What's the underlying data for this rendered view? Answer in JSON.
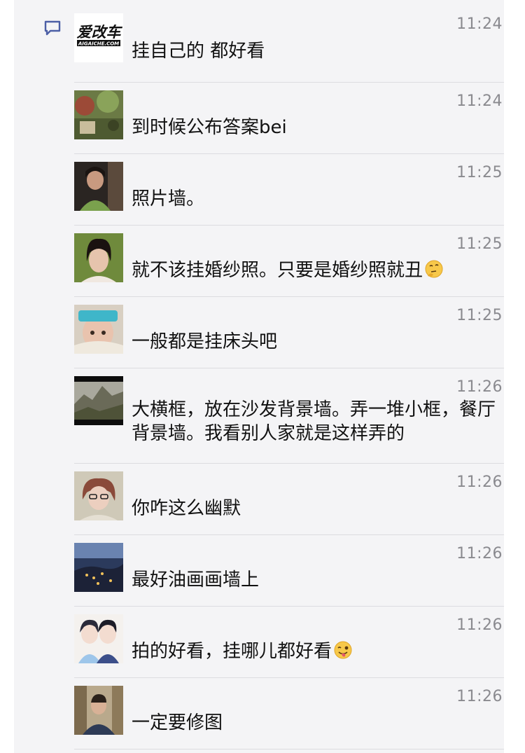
{
  "comments": [
    {
      "time": "11:24",
      "text": "挂自己的 都好看",
      "emoji": "",
      "avatar": "aichezhan-logo",
      "logo_main": "爱改车",
      "logo_sub": "AIGAICHE.COM"
    },
    {
      "time": "11:24",
      "text": "到时候公布答案bei",
      "emoji": "",
      "avatar": "garden-photo"
    },
    {
      "time": "11:25",
      "text": "照片墙。",
      "emoji": "",
      "avatar": "woman-dark-photo"
    },
    {
      "time": "11:25",
      "text": "就不该挂婚纱照。只要是婚纱照就丑",
      "emoji": "thinking-face-icon",
      "avatar": "woman-portrait-photo"
    },
    {
      "time": "11:25",
      "text": "一般都是挂床头吧",
      "emoji": "",
      "avatar": "baby-photo"
    },
    {
      "time": "11:26",
      "text": "大横框，放在沙发背景墙。弄一堆小框，餐厅背景墙。我看别人家就是这样弄的",
      "emoji": "",
      "avatar": "mountain-photo"
    },
    {
      "time": "11:26",
      "text": "你咋这么幽默",
      "emoji": "",
      "avatar": "glasses-woman-photo"
    },
    {
      "time": "11:26",
      "text": "最好油画画墙上",
      "emoji": "",
      "avatar": "night-city-photo"
    },
    {
      "time": "11:26",
      "text": "拍的好看，挂哪儿都好看",
      "emoji": "winking-tongue-face-icon",
      "avatar": "cartoon-couple-photo"
    },
    {
      "time": "11:26",
      "text": "一定要修图",
      "emoji": "",
      "avatar": "man-portrait-photo"
    }
  ],
  "colors": {
    "panel_bg": "#f4f4f6",
    "icon_blue": "#4c5fa6",
    "time_gray": "#8a8a8f",
    "divider": "#dcdce0"
  }
}
